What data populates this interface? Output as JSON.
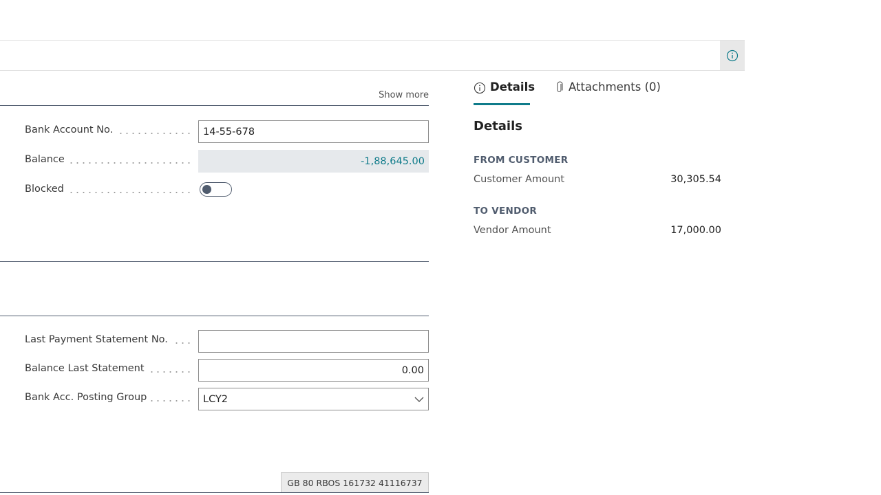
{
  "form": {
    "show_more": "Show more",
    "fields": {
      "bank_account_no": {
        "label": "Bank Account No.",
        "value": "14-55-678"
      },
      "balance": {
        "label": "Balance",
        "value": "-1,88,645.00"
      },
      "blocked": {
        "label": "Blocked",
        "checked": false
      },
      "last_payment_statement_no": {
        "label": "Last Payment Statement No.",
        "value": ""
      },
      "balance_last_statement": {
        "label": "Balance Last Statement",
        "value": "0.00"
      },
      "bank_acc_posting_group": {
        "label": "Bank Acc. Posting Group",
        "value": "LCY2"
      }
    },
    "iban": "GB 80 RBOS 161732 41116737"
  },
  "factbox": {
    "tabs": [
      {
        "label": "Details",
        "icon": "info-icon",
        "active": true
      },
      {
        "label": "Attachments (0)",
        "icon": "paperclip-icon",
        "active": false
      }
    ],
    "title": "Details",
    "from_customer": {
      "heading": "FROM CUSTOMER",
      "label": "Customer Amount",
      "value": "30,305.54"
    },
    "to_vendor": {
      "heading": "TO VENDOR",
      "label": "Vendor Amount",
      "value": "17,000.00"
    }
  },
  "colors": {
    "accent": "#0f7b8a",
    "section_line": "#505c6e"
  }
}
